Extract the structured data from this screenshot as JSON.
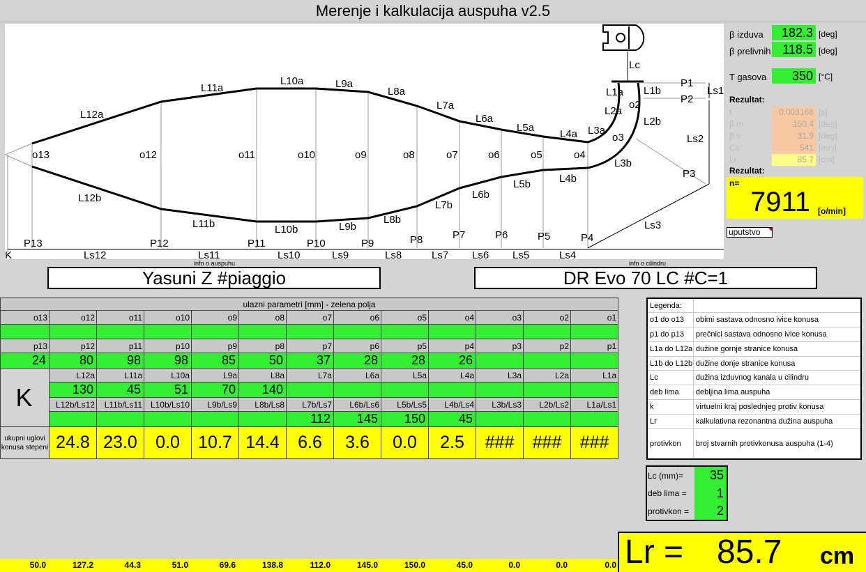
{
  "title": "Merenje i kalkulacija auspuha v2.5",
  "diagram": {
    "labels_o": [
      "o13",
      "o12",
      "o11",
      "o10",
      "o9",
      "o8",
      "o7",
      "o6",
      "o5",
      "o4",
      "o3",
      "o2"
    ],
    "labels_top": [
      "L12a",
      "L11a",
      "L10a",
      "L9a",
      "L8a",
      "L7a",
      "L6a",
      "L5a",
      "L4a",
      "L3a",
      "L2a",
      "L1a",
      "L1b",
      "L2b"
    ],
    "labels_bottom": [
      "L12b",
      "L11b",
      "L10b",
      "L9b",
      "L8b",
      "L7b",
      "L6b",
      "L5b",
      "L4b",
      "L3b"
    ],
    "labels_p": [
      "P13",
      "P12",
      "P11",
      "P10",
      "P9",
      "P8",
      "P7",
      "P6",
      "P5",
      "P4",
      "P3",
      "P2",
      "P1"
    ],
    "labels_ls": [
      "Ls12",
      "Ls11",
      "Ls10",
      "Ls9",
      "Ls8",
      "Ls7",
      "Ls6",
      "Ls5",
      "Ls4",
      "Ls3",
      "Ls2",
      "Ls1"
    ],
    "k": "K",
    "lc": "Lc"
  },
  "right": {
    "beta_izduva_label": "β izduva",
    "beta_izduva": "182.3",
    "beta_prelivnih_label": "β prelivnih",
    "beta_prelivnih": "118.5",
    "deg": "[deg]",
    "t_gasova_label": "T gasova",
    "t_gasova": "350",
    "t_unit": "[°C]",
    "rezultat_label": "Rezultat:",
    "pale": [
      {
        "label": "t",
        "value": "0.003168",
        "unit": "[s]"
      },
      {
        "label": "β m",
        "value": "150.4",
        "unit": "[deg]"
      },
      {
        "label": "β v",
        "value": "31.9",
        "unit": "[deg]"
      },
      {
        "label": "Cs",
        "value": "541",
        "unit": "[m/s]"
      },
      {
        "label": "Lr",
        "value": "85.7",
        "unit": "[cm]"
      }
    ],
    "rezultat2_label": "Rezultat:",
    "n_label": "n=",
    "n_value": "7911",
    "n_unit": "[o/min]",
    "uputstvo": "uputstvo"
  },
  "names": {
    "auspuh_info": "info o auspuhu",
    "auspuh": "Yasuni Z #piaggio",
    "cilindar_info": "info o cilindru",
    "cilindar": "DR Evo 70 LC #C=1"
  },
  "grid": {
    "header_title": "ulazni parametri [mm] - zelena polja",
    "o_headers": [
      "o13",
      "o12",
      "o11",
      "o10",
      "o9",
      "o8",
      "o7",
      "o6",
      "o5",
      "o4",
      "o3",
      "o2",
      "o1"
    ],
    "o_values": [
      "",
      "",
      "",
      "",
      "",
      "",
      "",
      "",
      "",
      "",
      "",
      "",
      ""
    ],
    "p_headers": [
      "p13",
      "p12",
      "p11",
      "p10",
      "p9",
      "p8",
      "p7",
      "p6",
      "p5",
      "p4",
      "p3",
      "p2",
      "p1"
    ],
    "p_values": [
      "24",
      "80",
      "98",
      "98",
      "85",
      "50",
      "37",
      "28",
      "28",
      "26",
      "",
      "",
      ""
    ],
    "k_label": "K",
    "la_headers": [
      "L12a",
      "L11a",
      "L10a",
      "L9a",
      "L8a",
      "L7a",
      "L6a",
      "L5a",
      "L4a",
      "L3a",
      "L2a",
      "L1a"
    ],
    "la_values": [
      "130",
      "45",
      "51",
      "70",
      "140",
      "",
      "",
      "",
      "",
      "",
      "",
      ""
    ],
    "lb_headers": [
      "L12b/Ls12",
      "L11b/Ls11",
      "L10b/Ls10",
      "L9b/Ls9",
      "L8b/Ls8",
      "L7b/Ls7",
      "L6b/Ls6",
      "L5b/Ls5",
      "L4b/Ls4",
      "L3b/Ls3",
      "L2b/Ls2",
      "L1a/Ls1"
    ],
    "lb_values": [
      "",
      "",
      "",
      "",
      "",
      "112",
      "145",
      "150",
      "45",
      "",
      "",
      ""
    ],
    "angle_label": "ukupni uglovi konusa stepeni",
    "angles": [
      "24.8",
      "23.0",
      "0.0",
      "10.7",
      "14.4",
      "6.6",
      "3.6",
      "0.0",
      "2.5",
      "###",
      "###",
      "###"
    ],
    "bottom_values": [
      "50.0",
      "127.2",
      "44.3",
      "51.0",
      "69.6",
      "138.8",
      "112.0",
      "145.0",
      "150.0",
      "45.0",
      "0.0",
      "0.0",
      "0.0"
    ]
  },
  "legend": [
    [
      "Legenda:",
      ""
    ],
    [
      "o1 do o13",
      "obimi sastava odnosno ivice konusa"
    ],
    [
      "p1 do p13",
      "prečnici sastava odnosno ivice konusa"
    ],
    [
      "L1a do L12a",
      "dužine gornje stranice konusa"
    ],
    [
      "L1b do L12b",
      "dužine donje stranice konusa"
    ],
    [
      "Lc",
      "dužina izduvnog kanala u cilindru"
    ],
    [
      "deb lima",
      "debljina lima auspuha"
    ],
    [
      "k",
      "virtuelni kraj poslednjeg protiv konusa"
    ],
    [
      "Lr",
      "kalkulativna rezonantna dužina auspuha"
    ],
    [
      "protivkon",
      "broj stvarnih protivkonusa auspuha (1-4)"
    ]
  ],
  "params": [
    {
      "label": "Lc (mm)=",
      "value": "35"
    },
    {
      "label": "deb lima =",
      "value": "1"
    },
    {
      "label": "protivkon =",
      "value": "2"
    }
  ],
  "lr": {
    "label": "Lr =",
    "value": "85.7",
    "unit": "cm"
  },
  "colors": {
    "green": "#33ee33",
    "yellow": "#ffff00",
    "orange_bar": "#ff9933",
    "pale_orange": "#f8c8a0"
  }
}
